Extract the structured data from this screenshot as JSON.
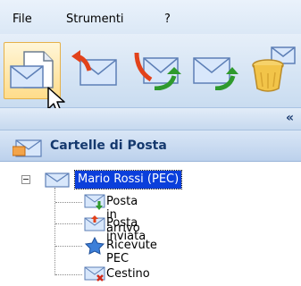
{
  "menu": {
    "file": "File",
    "tools": "Strumenti",
    "help": "?"
  },
  "toolbar": {
    "buttons": [
      {
        "icon": "new-mail-icon",
        "selected": true
      },
      {
        "icon": "reply-mail-icon"
      },
      {
        "icon": "forward-mail-icon"
      },
      {
        "icon": "send-receive-icon"
      },
      {
        "icon": "delete-mail-icon"
      }
    ]
  },
  "panel": {
    "collapse_label": "«",
    "title": "Cartelle di Posta"
  },
  "tree": {
    "root": {
      "label": "Mario Rossi (PEC)",
      "expanded": true
    },
    "children": [
      {
        "label": "Posta in arrivo",
        "icon": "inbox-icon"
      },
      {
        "label": "Posta inviata",
        "icon": "sent-icon"
      },
      {
        "label": "Ricevute PEC",
        "icon": "receipt-star-icon"
      },
      {
        "label": "Cestino",
        "icon": "trash-icon"
      }
    ]
  }
}
